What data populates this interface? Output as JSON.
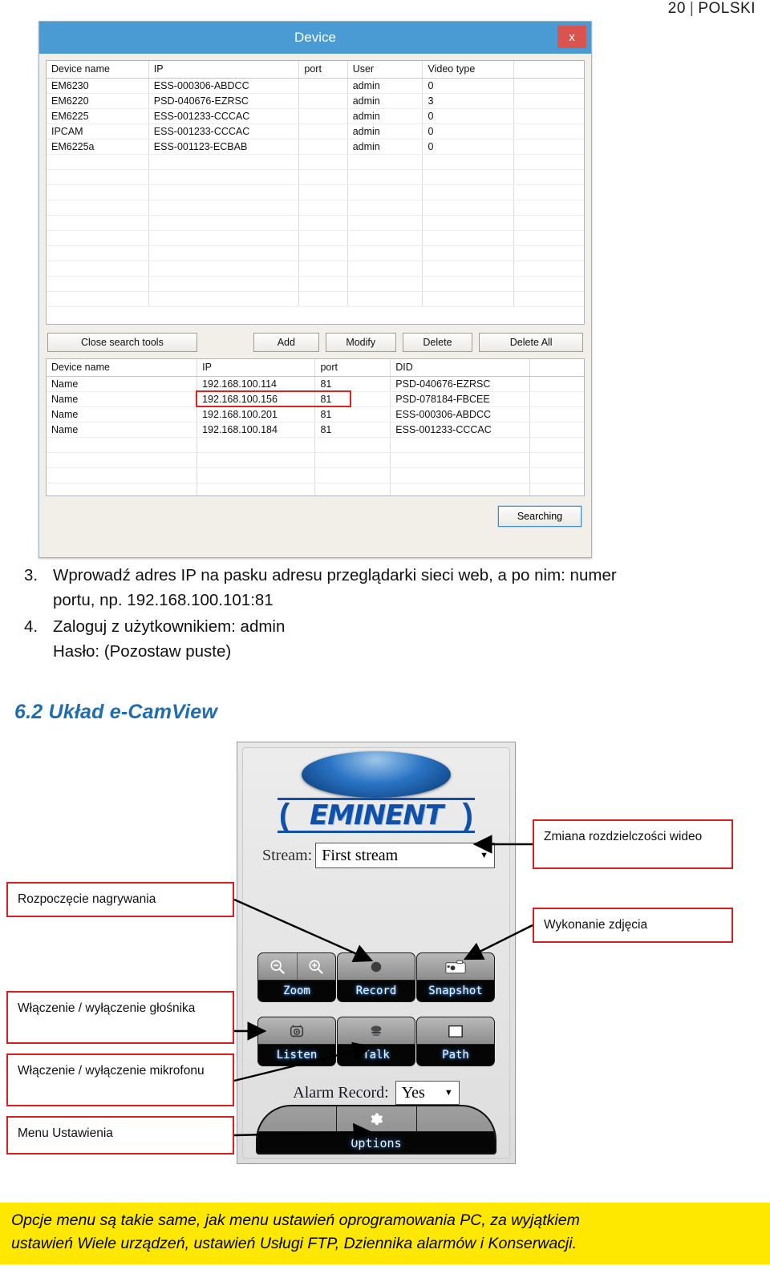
{
  "page_header": {
    "number": "20",
    "separator": "|",
    "language": "POLSKI"
  },
  "device_dialog": {
    "title": "Device",
    "close_label": "x",
    "device_table": {
      "columns": [
        "Device name",
        "IP",
        "port",
        "User",
        "Video type",
        ""
      ],
      "rows": [
        [
          "EM6230",
          "ESS-000306-ABDCC",
          "",
          "admin",
          "0",
          ""
        ],
        [
          "EM6220",
          "PSD-040676-EZRSC",
          "",
          "admin",
          "3",
          ""
        ],
        [
          "EM6225",
          "ESS-001233-CCCAC",
          "",
          "admin",
          "0",
          ""
        ],
        [
          "IPCAM",
          "ESS-001233-CCCAC",
          "",
          "admin",
          "0",
          ""
        ],
        [
          "EM6225a",
          "ESS-001123-ECBAB",
          "",
          "admin",
          "0",
          ""
        ]
      ]
    },
    "buttons": {
      "close_search_tools": "Close search tools",
      "add": "Add",
      "modify": "Modify",
      "delete": "Delete",
      "delete_all": "Delete All",
      "searching": "Searching"
    },
    "search_table": {
      "columns": [
        "Device name",
        "IP",
        "port",
        "DID",
        ""
      ],
      "rows": [
        [
          "Name",
          "192.168.100.114",
          "81",
          "PSD-040676-EZRSC",
          ""
        ],
        [
          "Name",
          "192.168.100.156",
          "81",
          "PSD-078184-FBCEE",
          ""
        ],
        [
          "Name",
          "192.168.100.201",
          "81",
          "ESS-000306-ABDCC",
          ""
        ],
        [
          "Name",
          "192.168.100.184",
          "81",
          "ESS-001233-CCCAC",
          ""
        ]
      ],
      "highlight_color": "#e02020"
    }
  },
  "instructions": [
    {
      "number": "3.",
      "line1": "Wprowadź adres IP na pasku adresu przeglądarki sieci web, a po nim: numer",
      "line2": "portu, np. 192.168.100.101:81"
    },
    {
      "number": "4.",
      "line1": "Zaloguj z użytkownikiem: admin",
      "line2": "Hasło: (Pozostaw puste)"
    }
  ],
  "section_heading": "6.2 Układ e-CamView",
  "ecamview": {
    "logo_text": "EMINENT",
    "logo_paren_left": "(",
    "logo_paren_right": ")",
    "stream_label": "Stream:",
    "stream_value": "First stream",
    "caret": "▼",
    "controls_row1": [
      {
        "label": "Zoom",
        "icon": "zoom-out-in-icon"
      },
      {
        "label": "Record",
        "icon": "record-dot-icon"
      },
      {
        "label": "Snapshot",
        "icon": "camera-icon"
      }
    ],
    "controls_row2": [
      {
        "label": "Listen",
        "icon": "speaker-icon"
      },
      {
        "label": "Talk",
        "icon": "microphone-icon"
      },
      {
        "label": "Path",
        "icon": "folder-icon"
      }
    ],
    "alarm_label": "Alarm Record:",
    "alarm_value": "Yes",
    "options_label": "Options",
    "options_icon": "gear-icon"
  },
  "annotations": [
    {
      "id": "resolution",
      "text": "Zmiana rozdzielczości wideo"
    },
    {
      "id": "start-recording",
      "text": "Rozpoczęcie nagrywania"
    },
    {
      "id": "snapshot",
      "text": "Wykonanie zdjęcia"
    },
    {
      "id": "speaker",
      "text": "Włączenie / wyłączenie głośnika"
    },
    {
      "id": "microphone",
      "text": "Włączenie / wyłączenie mikrofonu"
    },
    {
      "id": "settings-menu",
      "text": "Menu Ustawienia"
    }
  ],
  "footer_note": {
    "line1": "Opcje menu są takie same, jak menu ustawień oprogramowania PC, za wyjątkiem",
    "line2": "ustawień Wiele urządzeń, ustawień Usługi FTP, Dziennika alarmów i Konserwacji.",
    "background": "#ffe800"
  }
}
